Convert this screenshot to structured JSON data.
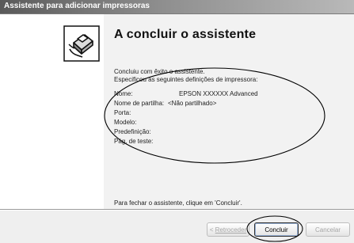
{
  "window": {
    "title": "Assistente para adicionar impressoras"
  },
  "heading": "A concluir o assistente",
  "intro": {
    "line1": "Concluiu com êxito o assistente.",
    "line2": "Especificou as seguintes definições de impressora:"
  },
  "settings": [
    {
      "label": "Nome:",
      "value": "EPSON XXXXXX Advanced"
    },
    {
      "label": "Nome de partilha:",
      "value": "<Não partilhado>"
    },
    {
      "label": "Porta:",
      "value": ""
    },
    {
      "label": "Modelo:",
      "value": ""
    },
    {
      "label": "Predefinição:",
      "value": ""
    },
    {
      "label": "Pág. de teste:",
      "value": ""
    }
  ],
  "footer_text": "Para fechar o assistente, clique em 'Concluir'.",
  "buttons": {
    "back": {
      "label": "Retroceder",
      "enabled": false
    },
    "finish": {
      "label": "Concluir",
      "enabled": true
    },
    "cancel": {
      "label": "Cancelar",
      "enabled": false
    }
  },
  "colors": {
    "titlebar_start": "#5a5a5a",
    "titlebar_end": "#b9b9b9",
    "content_background": "#f2f2f2",
    "annotation_circle": "#000000"
  },
  "icons": {
    "wizard": "printer-hand-icon"
  }
}
